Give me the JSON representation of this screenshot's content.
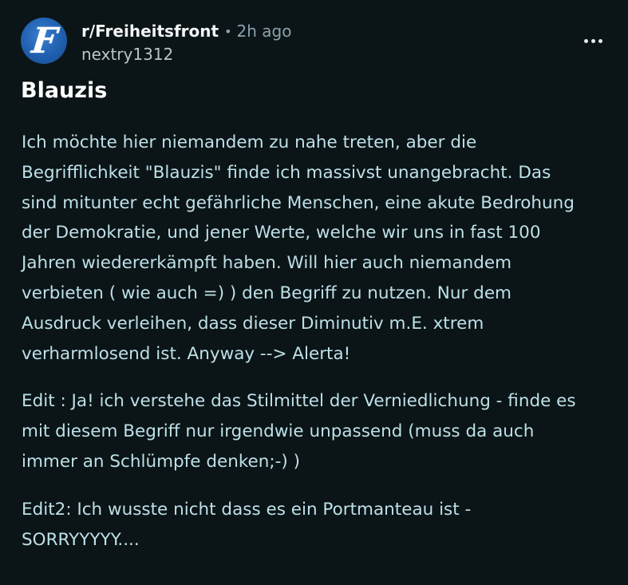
{
  "post": {
    "subreddit": "r/Freiheitsfront",
    "separator": "•",
    "time_ago": "2h ago",
    "author": "nextry1312",
    "avatar_letter": "F",
    "avatar_color": "#2a6bbd",
    "more_icon": "more-horizontal-icon",
    "title": "Blauzis",
    "paragraphs": [
      "Ich möchte hier niemandem zu nahe treten, aber die\nBegrifflichkeit \"Blauzis\" finde ich massivst unangebracht. Das\nsind mitunter echt gefährliche Menschen, eine akute Bedrohung\nder Demokratie, und jener Werte, welche wir uns in fast 100\nJahren wiedererkämpft haben. Will hier auch niemandem\nverbieten ( wie auch =) ) den Begriff zu nutzen. Nur dem\nAusdruck verleihen, dass dieser Diminutiv m.E. xtrem\nverharmlosend ist. Anyway --> Alerta!",
      "Edit : Ja! ich verstehe das Stilmittel der Verniedlichung - finde es\nmit diesem Begriff nur irgendwie unpassend (muss da auch\nimmer an Schlümpfe denken;-) )",
      "Edit2: Ich wusste nicht dass es ein Portmanteau ist -\nSORRYYYYY...."
    ]
  },
  "colors": {
    "background": "#0b1416",
    "body_text": "#bde0e8",
    "meta_text": "#8ba2ad"
  }
}
